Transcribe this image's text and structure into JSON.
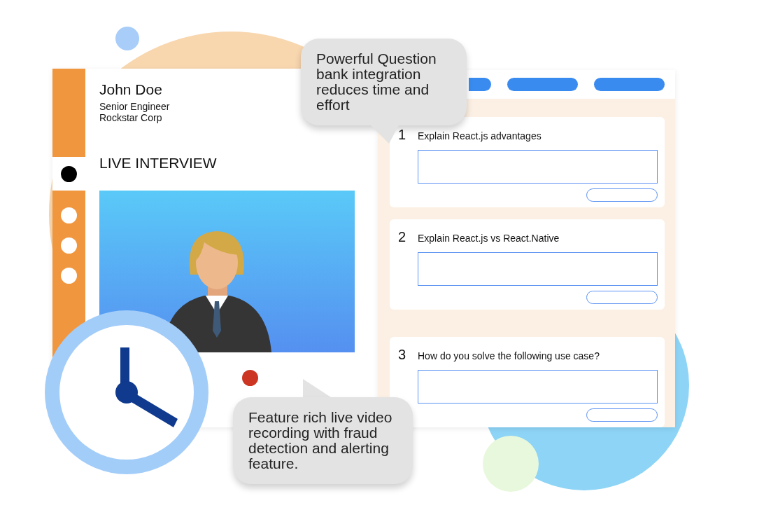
{
  "profile": {
    "name": "John Doe",
    "title": "Senior Engineer",
    "company": "Rockstar Corp"
  },
  "sidebar_dots": [
    {
      "selected": true
    },
    {
      "selected": false
    },
    {
      "selected": false
    },
    {
      "selected": false
    }
  ],
  "section_title": "LIVE INTERVIEW",
  "questions": [
    {
      "number": "1",
      "text": "Explain React.js advantages"
    },
    {
      "number": "2",
      "text": "Explain React.js vs React.Native"
    },
    {
      "number": "3",
      "text": "How do you solve the following use case?"
    }
  ],
  "callouts": [
    {
      "text": "Powerful Question bank integration reduces time and effort",
      "kind": "downward"
    },
    {
      "text": "Feature rich live video recording with fraud detection and alerting feature.",
      "kind": "upward"
    }
  ]
}
